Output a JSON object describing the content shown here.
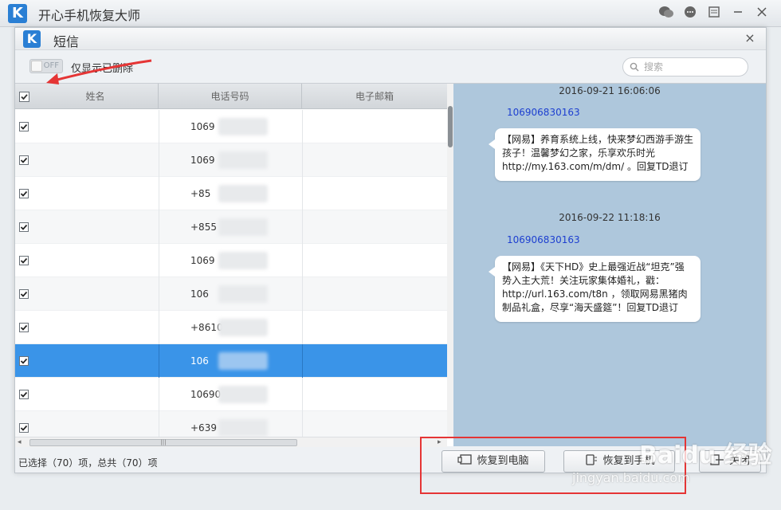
{
  "app": {
    "logo": "K",
    "title": "开心手机恢复大师",
    "icons": [
      "wechat-icon",
      "chat-icon",
      "menu-icon",
      "minimize-icon",
      "close-icon"
    ]
  },
  "dialog": {
    "logo": "K",
    "title": "短信",
    "close": "×"
  },
  "toolbar": {
    "toggle_state": "OFF",
    "toggle_label": "仅显示已删除",
    "search_placeholder": "搜索"
  },
  "table": {
    "columns": [
      "姓名",
      "电话号码",
      "电子邮箱"
    ],
    "rows": [
      {
        "checked": true,
        "phone": "1069",
        "selected": false
      },
      {
        "checked": true,
        "phone": "1069",
        "selected": false
      },
      {
        "checked": true,
        "phone": "+85",
        "selected": false
      },
      {
        "checked": true,
        "phone": "+855",
        "selected": false
      },
      {
        "checked": true,
        "phone": "1069",
        "selected": false
      },
      {
        "checked": true,
        "phone": "106",
        "selected": false
      },
      {
        "checked": true,
        "phone": "+8610",
        "selected": false
      },
      {
        "checked": true,
        "phone": "106",
        "selected": true
      },
      {
        "checked": true,
        "phone": "10690",
        "selected": false
      },
      {
        "checked": true,
        "phone": "+639",
        "selected": false
      }
    ]
  },
  "conversation": {
    "messages": [
      {
        "time": "2016-09-21 16:06:06",
        "sender": "106906830163",
        "text": "【网易】养育系统上线，快来梦幻西游手游生孩子！温馨梦幻之家，乐享欢乐时光 http://my.163.com/m/dm/ 。回复TD退订"
      },
      {
        "time": "2016-09-22 11:18:16",
        "sender": "106906830163",
        "text": "【网易】《天下HD》史上最强近战“坦克”强势入主大荒！关注玩家集体婚礼，戳：http://url.163.com/t8n ，领取网易黑猪肉制品礼盒，尽享“海天盛筵”！回复TD退订"
      }
    ]
  },
  "footer": {
    "status": "已选择（70）项，总共（70）项",
    "restore_pc_label": "恢复到电脑",
    "restore_phone_label": "恢复到手机",
    "close_label": "关闭"
  },
  "annotations": {
    "highlight_color": "#e53535"
  },
  "watermark": {
    "brand": "Baidu 经验",
    "url": "jingyan.baidu.com"
  },
  "colors": {
    "accent": "#2a7fd4",
    "selected_row": "#3a94e8",
    "conversation_bg": "#aec7dc",
    "sender_link": "#1d3fd0"
  }
}
